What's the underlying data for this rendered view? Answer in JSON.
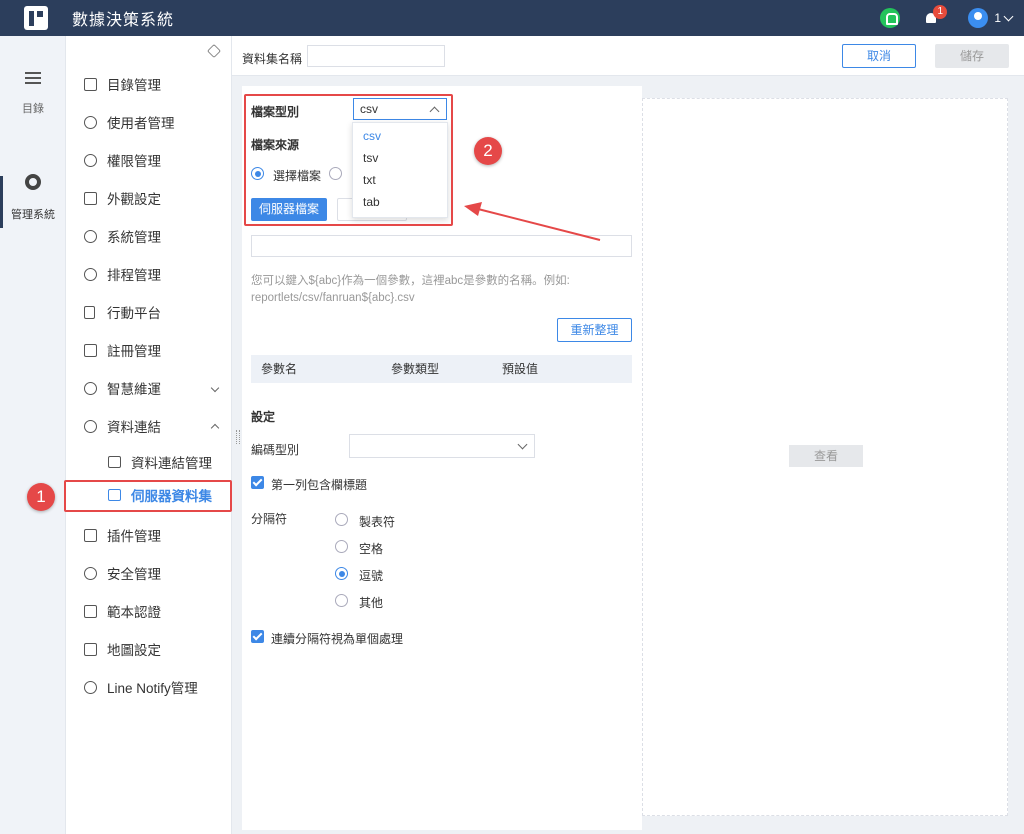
{
  "app": {
    "title": "數據決策系統",
    "notification_count": "1",
    "user_name": "1"
  },
  "rail": {
    "items": [
      {
        "label": "目錄",
        "icon": "list-icon"
      },
      {
        "label": "管理系統",
        "icon": "gear-icon"
      }
    ]
  },
  "sidebar": {
    "items": [
      {
        "label": "目錄管理",
        "icon": "catalog-icon"
      },
      {
        "label": "使用者管理",
        "icon": "user-icon"
      },
      {
        "label": "權限管理",
        "icon": "lock-icon"
      },
      {
        "label": "外觀設定",
        "icon": "paint-roller-icon"
      },
      {
        "label": "系統管理",
        "icon": "gear-icon"
      },
      {
        "label": "排程管理",
        "icon": "timer-icon"
      },
      {
        "label": "行動平台",
        "icon": "mobile-icon"
      },
      {
        "label": "註冊管理",
        "icon": "register-icon"
      },
      {
        "label": "智慧維運",
        "icon": "nodes-icon"
      },
      {
        "label": "資料連結",
        "icon": "paperclip-icon"
      },
      {
        "label": "資料連結管理",
        "icon": "server-icon"
      },
      {
        "label": "伺服器資料集",
        "icon": "dataset-icon"
      },
      {
        "label": "插件管理",
        "icon": "puzzle-icon"
      },
      {
        "label": "安全管理",
        "icon": "shield-icon"
      },
      {
        "label": "範本認證",
        "icon": "template-icon"
      },
      {
        "label": "地圖設定",
        "icon": "map-icon"
      },
      {
        "label": "Line Notify管理",
        "icon": "gear-icon"
      }
    ]
  },
  "annotations": {
    "step1": "1",
    "step2": "2"
  },
  "header": {
    "dataset_name_label": "資料集名稱",
    "dataset_name_value": "",
    "cancel_label": "取消",
    "save_label": "儲存"
  },
  "form": {
    "file_type_label": "檔案型別",
    "file_type_value": "csv",
    "file_type_options": [
      "csv",
      "tsv",
      "txt",
      "tab"
    ],
    "file_source_label": "檔案來源",
    "source_option_select": "選擇檔案",
    "server_file_button": "伺服器檔案",
    "path_value": "",
    "hint_line1": "您可以鍵入${abc}作為一個參數，這裡abc是參數的名稱。例如:",
    "hint_line2": "reportlets/csv/fanruan${abc}.csv",
    "refresh_button": "重新整理",
    "param_table_headers": [
      "參數名",
      "參數類型",
      "預設值"
    ],
    "settings_label": "設定",
    "encoding_label": "編碼型別",
    "encoding_value": "",
    "first_row_header_label": "第一列包含欄標題",
    "first_row_header_checked": true,
    "delimiter_label": "分隔符",
    "delimiter_options": [
      "製表符",
      "空格",
      "逗號",
      "其他"
    ],
    "delimiter_selected": "逗號",
    "consecutive_delimiter_label": "連續分隔符視為單個處理",
    "consecutive_delimiter_checked": true
  },
  "preview": {
    "view_button": "查看"
  },
  "colors": {
    "topbar": "#2c3e5c",
    "accent": "#3d88e6",
    "highlight": "#e54848"
  }
}
